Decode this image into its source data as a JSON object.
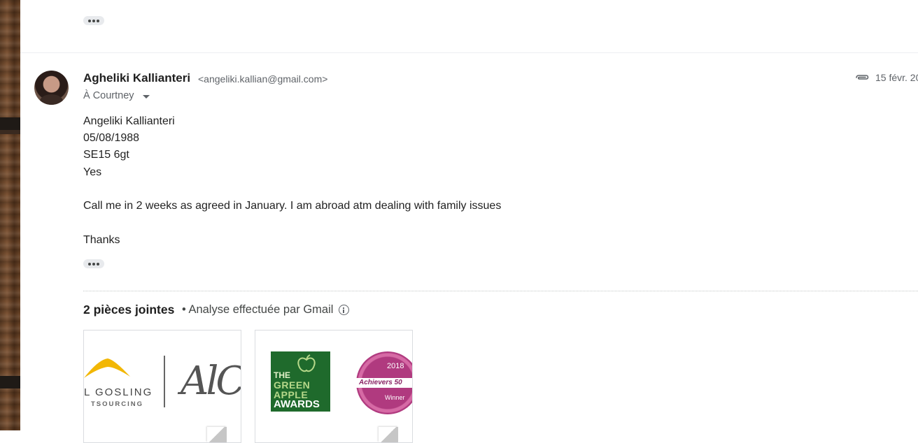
{
  "thread": {
    "collapsed_dots_label": "•••"
  },
  "message": {
    "sender_name": "Agheliki Kallianteri",
    "sender_email": "<angeliki.kallian@gmail.com>",
    "to_line": "À Courtney",
    "date": "15 févr. 20",
    "has_attachment": true,
    "body_lines": [
      "Angeliki Kallianteri",
      "05/08/1988",
      "SE15 6gt",
      "Yes",
      "Call me in 2 weeks as agreed in January. I am abroad atm dealing with family issues",
      "Thanks"
    ]
  },
  "attachments": {
    "title": "2 pièces jointes",
    "scan_note": "• Analyse effectuée par Gmail",
    "items": [
      {
        "logo_text_1": "L GOSLING",
        "logo_text_2": "TSOURCING",
        "logo_script": "AlC"
      },
      {
        "green_line_1": "THE",
        "green_line_2": "GREEN",
        "green_line_3": "APPLE",
        "green_line_4": "AWARDS",
        "badge_year": "2018",
        "badge_ribbon": "Achievers 50",
        "badge_winner": "Winner"
      }
    ]
  },
  "colors": {
    "text_primary": "#1f1f1f",
    "text_secondary": "#5f6368",
    "green_box": "#1f6a2c",
    "badge_magenta": "#b03a7f",
    "logo_yellow": "#f2b705"
  }
}
